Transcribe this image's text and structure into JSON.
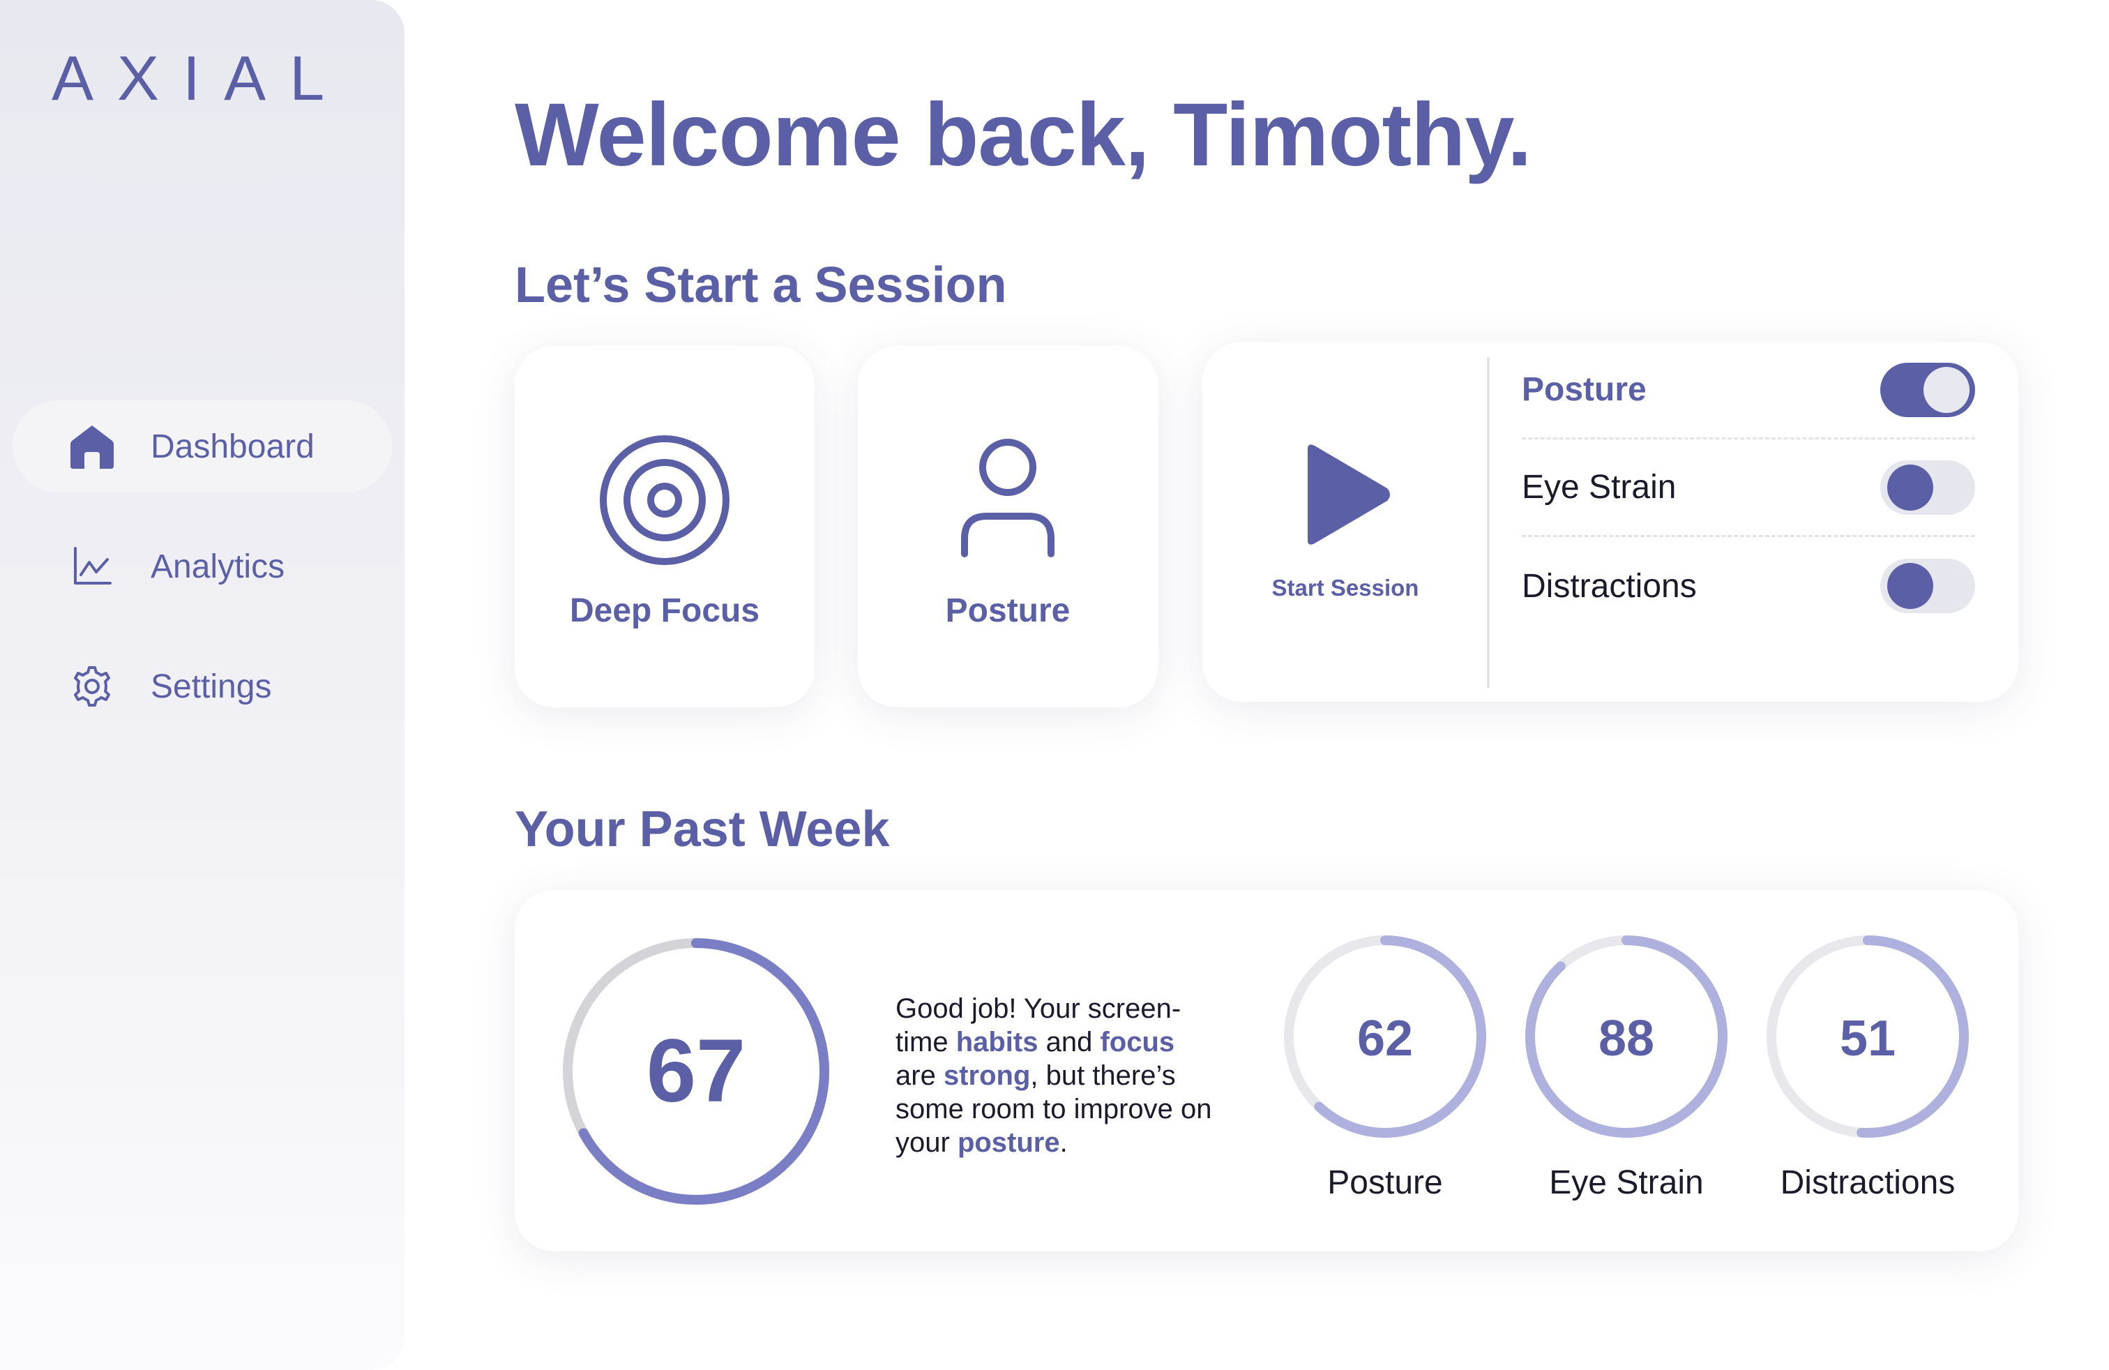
{
  "app": {
    "logo": "AXIAL"
  },
  "sidebar": {
    "items": [
      {
        "label": "Dashboard",
        "icon": "home-icon",
        "active": true
      },
      {
        "label": "Analytics",
        "icon": "chart-line-icon",
        "active": false
      },
      {
        "label": "Settings",
        "icon": "gear-icon",
        "active": false
      }
    ]
  },
  "main": {
    "title": "Welcome back, Timothy.",
    "session_heading": "Let’s Start a Session",
    "modes": [
      {
        "label": "Deep Focus",
        "icon": "target-icon"
      },
      {
        "label": "Posture",
        "icon": "person-icon"
      }
    ],
    "start": {
      "label": "Start Session",
      "icon": "play-icon"
    },
    "toggles": [
      {
        "label": "Posture",
        "on": true
      },
      {
        "label": "Eye Strain",
        "on": false
      },
      {
        "label": "Distractions",
        "on": false
      }
    ],
    "week_heading": "Your Past Week",
    "overall_score": {
      "value": "67",
      "fraction": 0.67
    },
    "summary": {
      "p1": "Good job! Your screen-time ",
      "w1": "habits",
      "p2": " and ",
      "w2": "focus",
      "p3": " are ",
      "w3": "strong",
      "p4": ", but there’s some room to improve on your ",
      "w4": "posture",
      "p5": "."
    },
    "metrics": [
      {
        "label": "Posture",
        "value": "62",
        "fraction": 0.62
      },
      {
        "label": "Eye Strain",
        "value": "88",
        "fraction": 0.88
      },
      {
        "label": "Distractions",
        "value": "51",
        "fraction": 0.51
      }
    ]
  },
  "colors": {
    "accent": "#5a5fa6",
    "ring_main": "#7a7ec4",
    "ring_metric": "#aeb1dd",
    "ring_track": "#d4d4d8",
    "ring_track_light": "#e8e8ec"
  }
}
